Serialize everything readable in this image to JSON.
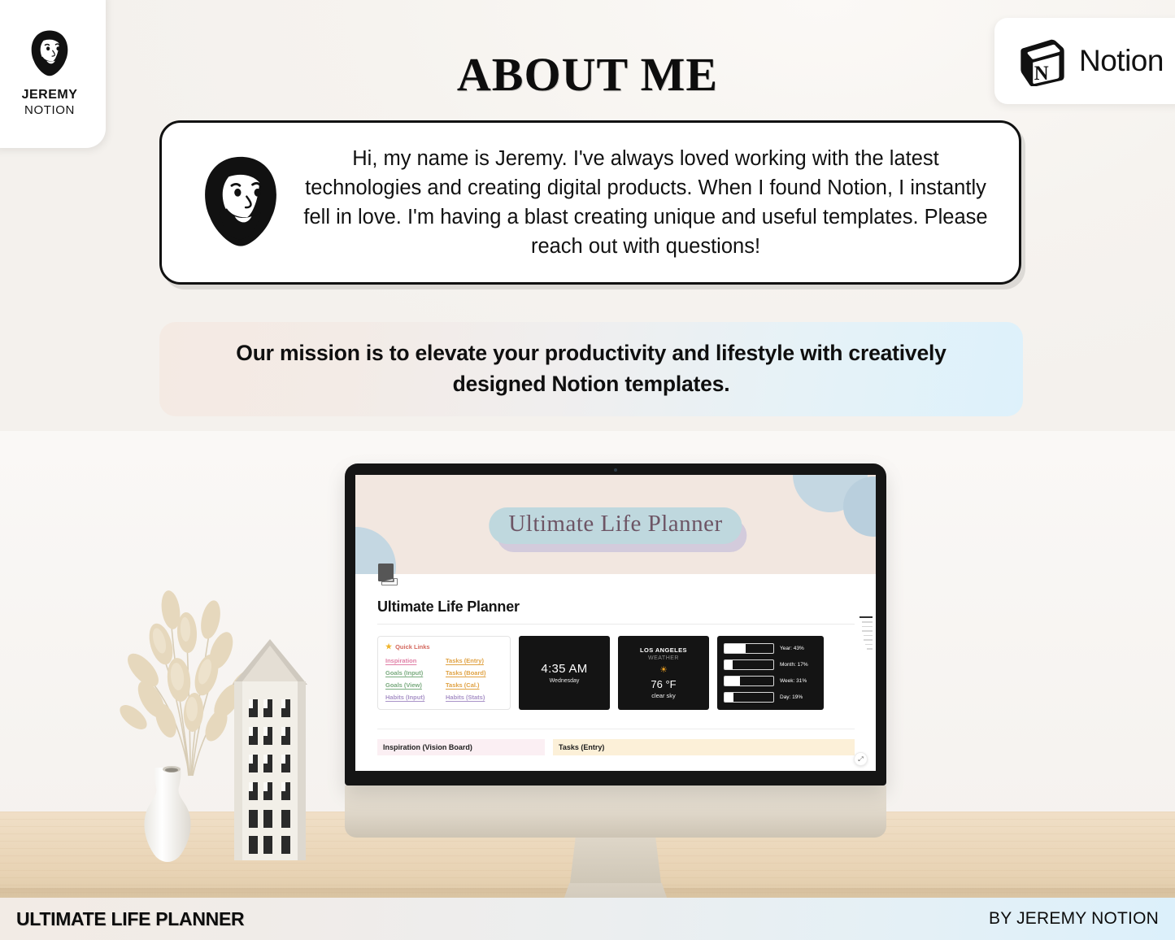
{
  "brand": {
    "avatar_icon": "bearded-man-avatar-icon",
    "name": "JEREMY",
    "subtitle": "NOTION"
  },
  "notion_badge": {
    "cube_icon": "notion-cube-icon",
    "label": "Notion"
  },
  "header": {
    "title": "ABOUT ME"
  },
  "bio": {
    "avatar_icon": "bearded-man-face-icon",
    "text": "Hi, my name is Jeremy. I've always loved working with the latest technologies and creating digital products. When I found Notion, I instantly fell in love. I'm having a blast creating unique and useful templates. Please reach out with questions!"
  },
  "mission": {
    "text": "Our mission is to elevate your productivity and lifestyle with creatively designed Notion templates."
  },
  "notion_page": {
    "cover_title": "Ultimate Life Planner",
    "page_icon": "book-pages-icon",
    "page_heading": "Ultimate Life Planner",
    "quick_links": {
      "star_icon": "star-icon",
      "heading": "Quick Links",
      "column_left": [
        {
          "label": "Inspiration",
          "color_key": "c-pink"
        },
        {
          "label": "Goals (Input)",
          "color_key": "c-green"
        },
        {
          "label": "Goals (View)",
          "color_key": "c-green"
        },
        {
          "label": "Habits (Input)",
          "color_key": "c-purp"
        }
      ],
      "column_right": [
        {
          "label": "Tasks (Entry)",
          "color_key": "c-orng"
        },
        {
          "label": "Tasks (Board)",
          "color_key": "c-orng"
        },
        {
          "label": "Tasks (Cal.)",
          "color_key": "c-orng"
        },
        {
          "label": "Habits (Stats)",
          "color_key": "c-purp"
        }
      ]
    },
    "clock": {
      "time": "4:35 AM",
      "day": "Wednesday"
    },
    "weather": {
      "city": "LOS ANGELES",
      "label": "WEATHER",
      "sun_icon": "sun-icon",
      "temperature": "76 °F",
      "description": "clear sky"
    },
    "progress": [
      {
        "label": "Year: 43%",
        "percent": 43
      },
      {
        "label": "Month: 17%",
        "percent": 17
      },
      {
        "label": "Week: 31%",
        "percent": 31
      },
      {
        "label": "Day: 19%",
        "percent": 19
      }
    ],
    "databases": [
      {
        "label": "Inspiration (Vision Board)",
        "tone": "pink"
      },
      {
        "label": "Tasks (Entry)",
        "tone": "yellow"
      }
    ],
    "expand_icon": "expand-arrows-icon"
  },
  "scene": {
    "vase_icon": "white-vase-icon",
    "pampas_icon": "dried-pampas-grass-icon",
    "house_icon": "decorative-house-icon",
    "monitor_icon": "desktop-monitor-icon"
  },
  "footer": {
    "left": "ULTIMATE LIFE PLANNER",
    "right": "BY JEREMY NOTION"
  },
  "colors": {
    "page_bg": "#f6f3ef",
    "cover_bg": "#f2e7e0",
    "cover_accent": "#c4d7e2",
    "mission_left": "#f4eae3",
    "mission_right": "#ddf1fb",
    "widget_dark": "#141414"
  }
}
